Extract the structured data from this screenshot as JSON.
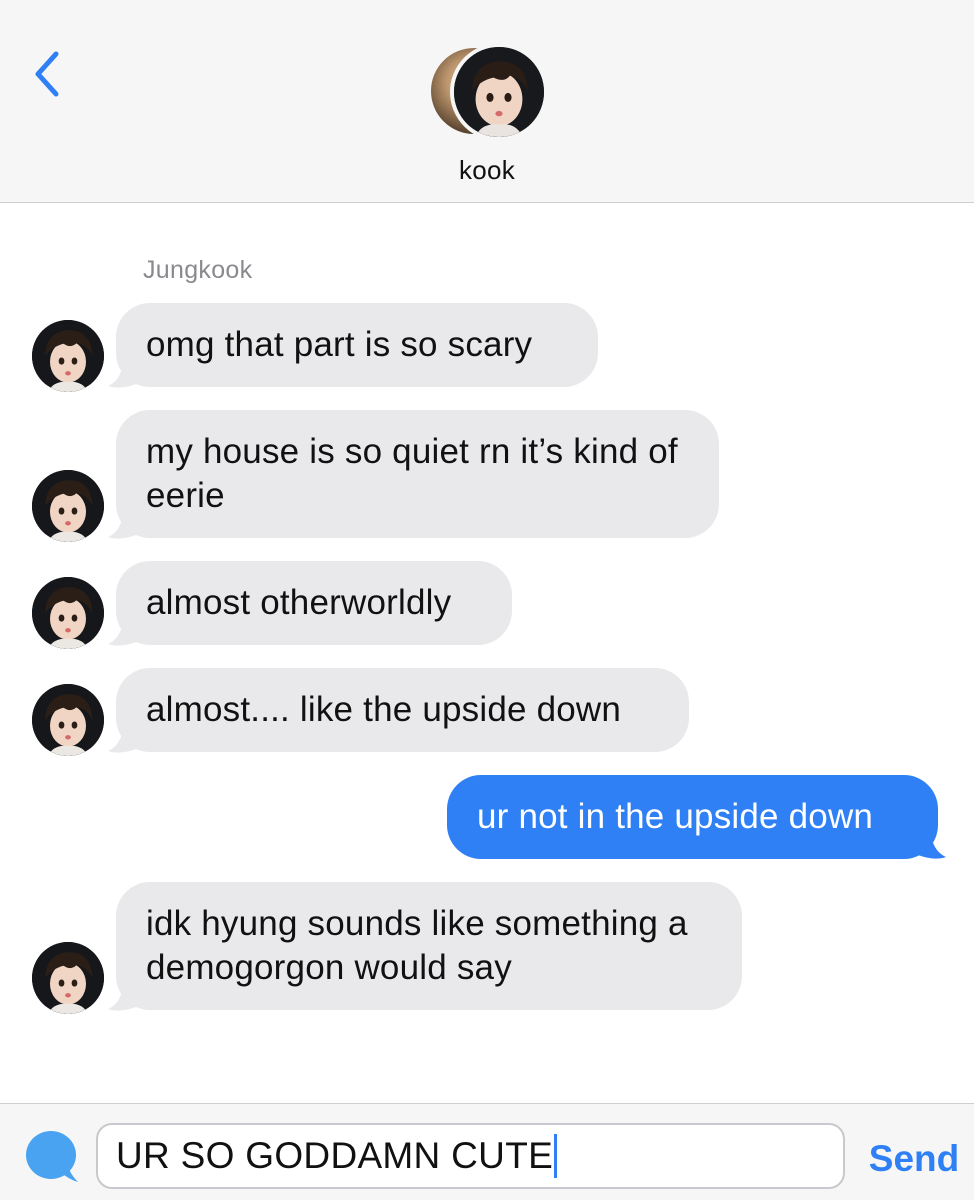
{
  "header": {
    "contact_name": "kook",
    "back_icon": "chevron-left-icon"
  },
  "thread": {
    "sender_label": "Jungkook",
    "messages": [
      {
        "from": "incoming",
        "text": "omg that part is so scary"
      },
      {
        "from": "incoming",
        "text": "my house is so quiet rn it’s kind of eerie"
      },
      {
        "from": "incoming",
        "text": "almost otherworldly"
      },
      {
        "from": "incoming",
        "text": "almost.... like the upside down"
      },
      {
        "from": "outgoing",
        "text": "ur not in the upside down"
      },
      {
        "from": "incoming",
        "text": "idk hyung sounds like something a demogorgon would say"
      }
    ]
  },
  "composer": {
    "input_value": "UR SO GODDAMN CUTE",
    "send_label": "Send",
    "app_icon": "chat-bubble-icon"
  },
  "colors": {
    "accent": "#2f80f5",
    "incoming_bubble": "#e9e9eb",
    "outgoing_bubble": "#2f80f5",
    "header_bg": "#f6f6f6",
    "label_gray": "#8a8a8e"
  }
}
